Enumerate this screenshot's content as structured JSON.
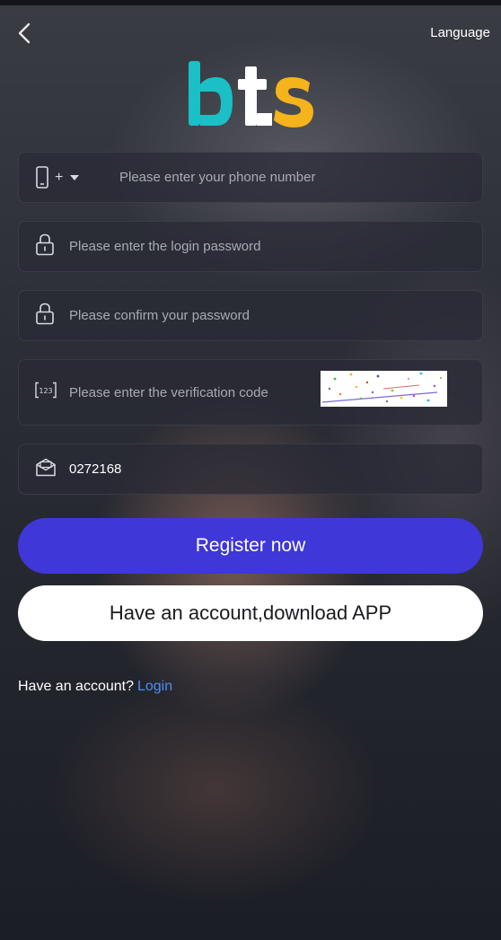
{
  "header": {
    "back_icon": "chevron-left-icon",
    "language_label": "Language"
  },
  "logo": {
    "text": "bts",
    "colors": {
      "b": "#1bbfc6",
      "t": "#ffffff",
      "s": "#f5b31c"
    }
  },
  "form": {
    "phone": {
      "prefix": "+",
      "placeholder": "Please enter your phone number",
      "icon": "phone-icon"
    },
    "password": {
      "placeholder": "Please enter the login password",
      "icon": "lock-icon"
    },
    "confirm_password": {
      "placeholder": "Please confirm your password",
      "icon": "lock-icon"
    },
    "verification": {
      "placeholder": "Please enter the verification code",
      "icon": "code-123-icon"
    },
    "invite": {
      "value": "0272168",
      "icon": "envelope-icon"
    }
  },
  "buttons": {
    "register_label": "Register now",
    "download_label": "Have an account,download APP"
  },
  "footer": {
    "prompt": "Have an account?",
    "login_link": "Login"
  },
  "colors": {
    "accent": "#3f37d8",
    "link": "#4f8ef5"
  }
}
